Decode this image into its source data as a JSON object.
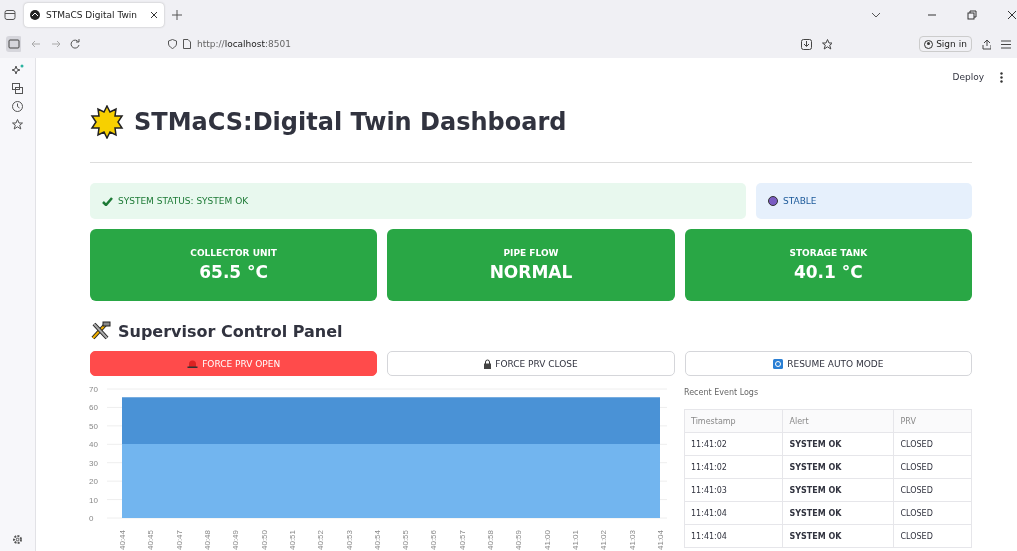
{
  "browser": {
    "tab_title": "STMaCS Digital Twin",
    "url": "http://**localhost**:8501",
    "sign_in": "Sign in"
  },
  "header": {
    "deploy": "Deploy"
  },
  "title": "STMaCS:Digital Twin Dashboard",
  "status": {
    "text": "SYSTEM STATUS: SYSTEM OK"
  },
  "trend": {
    "text": "STABLE"
  },
  "metrics": [
    {
      "label": "COLLECTOR UNIT",
      "value": "65.5 °C"
    },
    {
      "label": "PIPE FLOW",
      "value": "NORMAL"
    },
    {
      "label": "STORAGE TANK",
      "value": "40.1 °C"
    }
  ],
  "control_panel": {
    "title": "Supervisor Control Panel",
    "buttons": [
      {
        "label": "FORCE PRV OPEN",
        "kind": "primary"
      },
      {
        "label": "FORCE PRV CLOSE",
        "kind": "secondary"
      },
      {
        "label": "RESUME AUTO MODE",
        "kind": "secondary"
      }
    ]
  },
  "chart_data": {
    "type": "area",
    "x": [
      "40:44",
      "40:45",
      "40:47",
      "40:48",
      "40:49",
      "40:50",
      "40:51",
      "40:52",
      "40:53",
      "40:54",
      "40:55",
      "40:56",
      "40:57",
      "40:58",
      "40:59",
      "41:00",
      "41:01",
      "41:02",
      "41:03",
      "41:04"
    ],
    "series": [
      {
        "color": "#4a92d6",
        "values": [
          65.5,
          65.5,
          65.5,
          65.5,
          65.5,
          65.5,
          65.5,
          65.5,
          65.5,
          65.5,
          65.5,
          65.5,
          65.5,
          65.5,
          65.5,
          65.5,
          65.5,
          65.5,
          65.5,
          65.5
        ]
      },
      {
        "color": "#72b5ef",
        "values": [
          40.1,
          40.1,
          40.1,
          40.1,
          40.1,
          40.1,
          40.1,
          40.1,
          40.1,
          40.1,
          40.1,
          40.1,
          40.1,
          40.1,
          40.1,
          40.1,
          40.1,
          40.1,
          40.1,
          40.1
        ]
      }
    ],
    "ylim": [
      0,
      70
    ],
    "grid": true,
    "yticks": [
      0,
      10,
      20,
      30,
      40,
      50,
      60,
      70
    ]
  },
  "event_log": {
    "title": "Recent Event Logs",
    "columns": [
      "Timestamp",
      "Alert",
      "PRV"
    ],
    "rows": [
      [
        "11:41:02",
        "SYSTEM OK",
        "CLOSED"
      ],
      [
        "11:41:02",
        "SYSTEM OK",
        "CLOSED"
      ],
      [
        "11:41:03",
        "SYSTEM OK",
        "CLOSED"
      ],
      [
        "11:41:04",
        "SYSTEM OK",
        "CLOSED"
      ],
      [
        "11:41:04",
        "SYSTEM OK",
        "CLOSED"
      ]
    ]
  }
}
